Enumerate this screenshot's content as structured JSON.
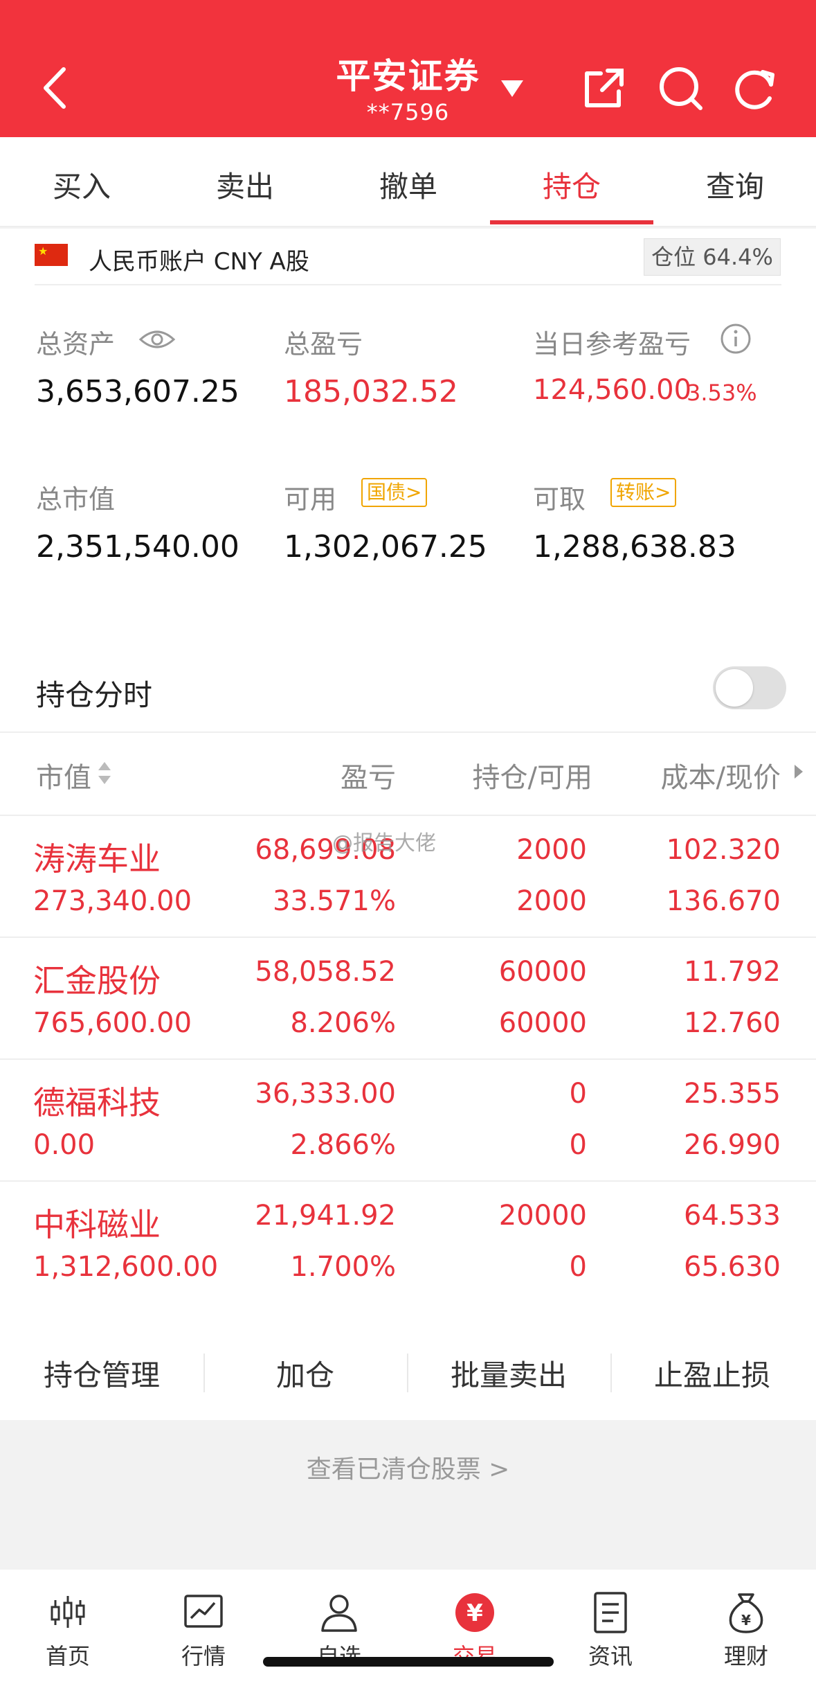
{
  "header": {
    "title": "平安证券",
    "account_masked": "**7596",
    "bg_color": "#f2333d"
  },
  "tabs": [
    {
      "label": "买入"
    },
    {
      "label": "卖出"
    },
    {
      "label": "撤单"
    },
    {
      "label": "持仓",
      "active": true
    },
    {
      "label": "查询"
    }
  ],
  "account": {
    "label": "人民币账户 CNY A股",
    "position_ratio": "仓位 64.4%"
  },
  "stats": {
    "total_assets_label": "总资产",
    "total_assets": "3,653,607.25",
    "total_pnl_label": "总盈亏",
    "total_pnl": "185,032.52",
    "daily_pnl_label": "当日参考盈亏",
    "daily_pnl": "124,560.00",
    "daily_pnl_pct": "3.53%",
    "market_value_label": "总市值",
    "market_value": "2,351,540.00",
    "available_label": "可用",
    "available_badge": "国债>",
    "available": "1,302,067.25",
    "withdrawable_label": "可取",
    "withdrawable_badge": "转账>",
    "withdrawable": "1,288,638.83"
  },
  "positions": {
    "toggle_label": "持仓分时",
    "toggle_on": false,
    "columns": [
      "市值",
      "盈亏",
      "持仓/可用",
      "成本/现价"
    ],
    "rows": [
      {
        "name": "涛涛车业",
        "market_value": "273,340.00",
        "pnl": "68,699.08",
        "pnl_pct": "33.571%",
        "hold": "2000",
        "avail": "2000",
        "cost": "102.320",
        "price": "136.670"
      },
      {
        "name": "汇金股份",
        "market_value": "765,600.00",
        "pnl": "58,058.52",
        "pnl_pct": "8.206%",
        "hold": "60000",
        "avail": "60000",
        "cost": "11.792",
        "price": "12.760"
      },
      {
        "name": "德福科技",
        "market_value": "0.00",
        "pnl": "36,333.00",
        "pnl_pct": "2.866%",
        "hold": "0",
        "avail": "0",
        "cost": "25.355",
        "price": "26.990"
      },
      {
        "name": "中科磁业",
        "market_value": "1,312,600.00",
        "pnl": "21,941.92",
        "pnl_pct": "1.700%",
        "hold": "20000",
        "avail": "0",
        "cost": "64.533",
        "price": "65.630"
      }
    ]
  },
  "actions": [
    "持仓管理",
    "加仓",
    "批量卖出",
    "止盈止损"
  ],
  "cleared_link": "查看已清仓股票 >",
  "watermark": "@报告大佬",
  "bottom_nav": [
    {
      "label": "首页",
      "icon": "candlestick-icon"
    },
    {
      "label": "行情",
      "icon": "chart-icon"
    },
    {
      "label": "自选",
      "icon": "person-icon"
    },
    {
      "label": "交易",
      "icon": "yuan-icon",
      "active": true
    },
    {
      "label": "资讯",
      "icon": "document-icon"
    },
    {
      "label": "理财",
      "icon": "money-bag-icon"
    }
  ],
  "colors": {
    "accent": "#e8323c",
    "badge": "#f0a500"
  }
}
